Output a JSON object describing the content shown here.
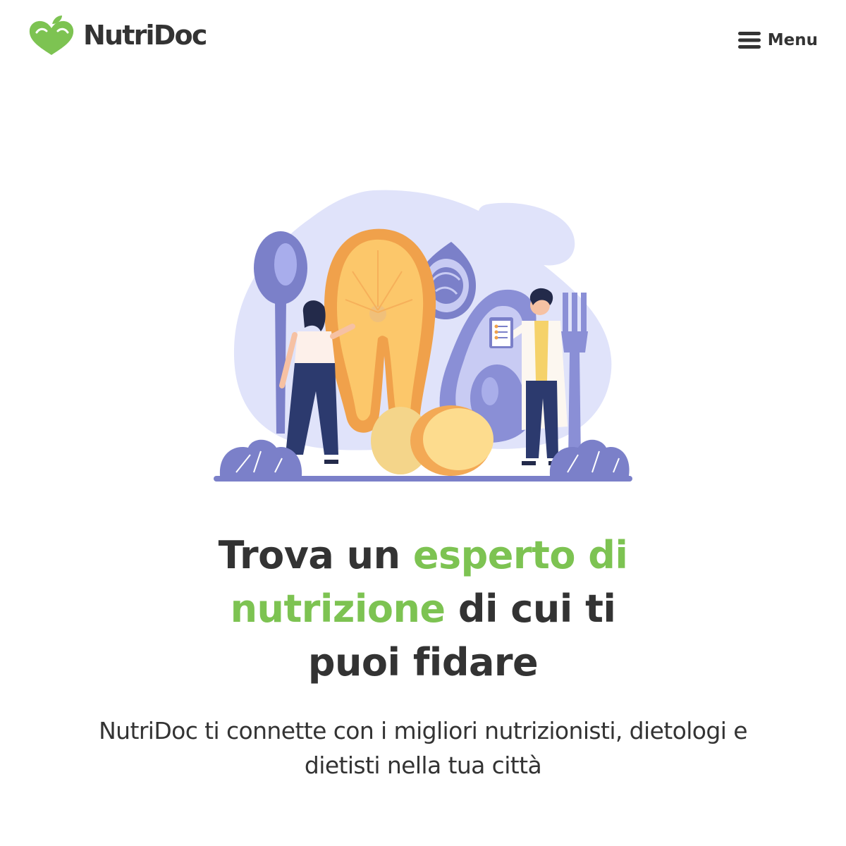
{
  "header": {
    "brand_name": "NutriDoc",
    "menu_label": "Menu",
    "logo_icon": "apple-heart-icon",
    "menu_icon": "hamburger-icon"
  },
  "hero": {
    "headline_part1": "Trova un ",
    "headline_highlight": "esperto di nutrizione",
    "headline_part2": " di cui ti puoi fidare",
    "subtitle": "NutriDoc ti connette con i migliori nutrizionisti, dietologi e dietisti nella tua città"
  },
  "colors": {
    "brand_green": "#7dc352",
    "text_dark": "#333333",
    "illustration_lavender": "#e0e3fa",
    "illustration_indigo": "#7b80c9"
  }
}
